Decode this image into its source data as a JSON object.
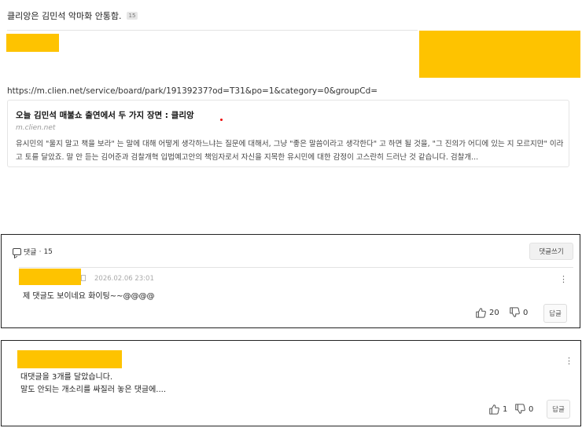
{
  "post": {
    "title": "클리앙은 김민석 악마화 안통함.",
    "comment_count_badge": "15",
    "url": "https://m.clien.net/service/board/park/19139237?od=T31&po=1&category=0&groupCd="
  },
  "link_preview": {
    "title": "오늘 김민석 매불쇼 출연에서 두 가지 장면 : 클리앙",
    "domain": "m.clien.net",
    "description": "유시민의 \"울지 말고 책을 보라\" 는 말에 대해 어떻게 생각하느냐는 질문에 대해서, 그냥 \"좋은 말씀이라고 생각한다\" 고 하면 될 것을, \"그 진의가 어디에 있는 지 모르지만\" 이라고 토를 달았죠. 말 안 듣는 김어준과 검찰개혁 입법예고안의 책임자로서 자신을 지목한 유시민에 대한 감정이 고스란히 드러난 것 같습니다. 검찰개..."
  },
  "comments": {
    "header_label": "댓글",
    "header_separator": "·",
    "header_count": "15",
    "write_button": "댓글쓰기",
    "items": [
      {
        "date": "2026.02.06 23:01",
        "text": "제 댓글도 보이네요 화이팅~~@@@@",
        "likes": "20",
        "dislikes": "0",
        "reply_label": "답글"
      },
      {
        "text_line1": "대댓글을 3개를 달았습니다.",
        "text_line2": "말도 안되는 개소리를 싸질러 놓은 댓글에....",
        "likes": "1",
        "dislikes": "0",
        "reply_label": "답글"
      }
    ]
  },
  "colors": {
    "redaction": "#fec300",
    "border": "#222222"
  },
  "icons": {
    "more": "vertical-ellipsis-icon",
    "like": "thumbs-up-icon",
    "dislike": "thumbs-down-icon",
    "comment": "chat-bubble-icon"
  }
}
